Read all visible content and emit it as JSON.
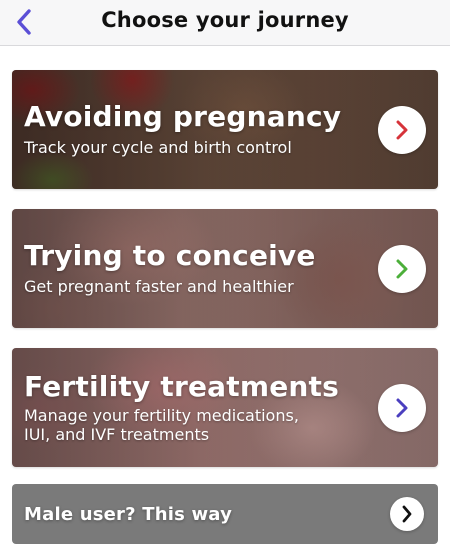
{
  "header": {
    "title": "Choose your journey",
    "back_icon": "chevron-left-icon",
    "accent_color": "#5b4fd6"
  },
  "cards": [
    {
      "id": "avoiding-pregnancy",
      "title": "Avoiding pregnancy",
      "subtitle": "Track your cycle and birth control",
      "arrow_icon": "chevron-right-icon",
      "arrow_color": "#d6333a"
    },
    {
      "id": "trying-to-conceive",
      "title": "Trying to conceive",
      "subtitle": "Get pregnant faster and healthier",
      "arrow_icon": "chevron-right-icon",
      "arrow_color": "#4caf3a"
    },
    {
      "id": "fertility-treatments",
      "title": "Fertility treatments",
      "subtitle_line1": "Manage your fertility medications,",
      "subtitle_line2": "IUI, and IVF treatments",
      "arrow_icon": "chevron-right-icon",
      "arrow_color": "#4b3fbf"
    }
  ],
  "male_card": {
    "label": "Male user? This way",
    "arrow_icon": "chevron-right-icon",
    "arrow_color": "#111111"
  }
}
